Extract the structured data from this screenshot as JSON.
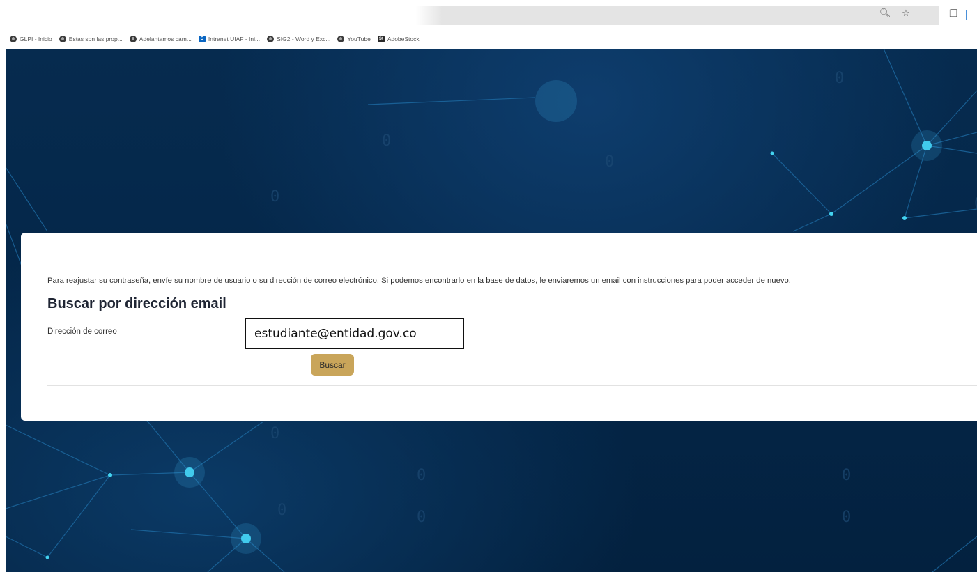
{
  "browser": {
    "bookmarks": [
      {
        "label": "GLPI - Inicio",
        "icon": "globe-icon"
      },
      {
        "label": "Estas son las prop...",
        "icon": "globe-icon"
      },
      {
        "label": "Adelantamos cam...",
        "icon": "globe-icon"
      },
      {
        "label": "Intranet UIAF - Ini...",
        "icon": "sharepoint-icon"
      },
      {
        "label": "SIG2 - Word y Exc...",
        "icon": "globe-icon"
      },
      {
        "label": "YouTube",
        "icon": "globe-icon"
      },
      {
        "label": "AdobeStock",
        "icon": "adobestock-icon"
      }
    ],
    "sharepoint_badge": "S",
    "adobestock_badge": "St"
  },
  "form": {
    "intro": "Para reajustar su contraseña, envíe su nombre de usuario o su dirección de correo electrónico. Si podemos encontrarlo en la base de datos, le enviaremos un email con instrucciones para poder acceder de nuevo.",
    "heading": "Buscar por dirección email",
    "email_label": "Dirección de correo",
    "email_value": "estudiante@entidad.gov.co",
    "button_label": "Buscar"
  },
  "colors": {
    "button": "#c9a55a",
    "background": "#042648",
    "arrow": "#3b6fc4"
  }
}
